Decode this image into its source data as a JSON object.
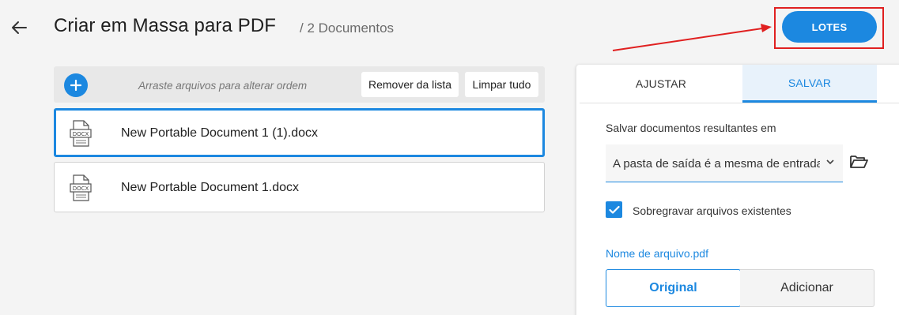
{
  "header": {
    "title": "Criar em Massa para PDF",
    "doc_count": "/ 2 Documentos",
    "lotes_label": "LOTES"
  },
  "toolbar": {
    "drag_hint": "Arraste arquivos para alterar ordem",
    "remove_label": "Remover da lista",
    "clear_label": "Limpar tudo"
  },
  "files": [
    {
      "name": "New Portable Document 1 (1).docx",
      "type": "DOCX",
      "selected": true
    },
    {
      "name": "New Portable Document 1.docx",
      "type": "DOCX",
      "selected": false
    }
  ],
  "panel": {
    "tabs": [
      {
        "label": "AJUSTAR",
        "active": false
      },
      {
        "label": "SALVAR",
        "active": true
      }
    ],
    "save_label": "Salvar documentos resultantes em",
    "folder_value": "A pasta de saída é a mesma de entrada",
    "overwrite_checked": true,
    "overwrite_label": "Sobregravar arquivos existentes",
    "filename_label": "Nome de arquivo.pdf",
    "filename_options": [
      {
        "label": "Original",
        "selected": true
      },
      {
        "label": "Adicionar",
        "selected": false
      }
    ]
  },
  "colors": {
    "accent": "#1c88e0",
    "highlight": "#e02020",
    "background": "#f4f4f4"
  },
  "icons": [
    "back-arrow-icon",
    "plus-icon",
    "docx-file-icon",
    "chevron-down-icon",
    "folder-open-icon",
    "checkmark-icon"
  ]
}
